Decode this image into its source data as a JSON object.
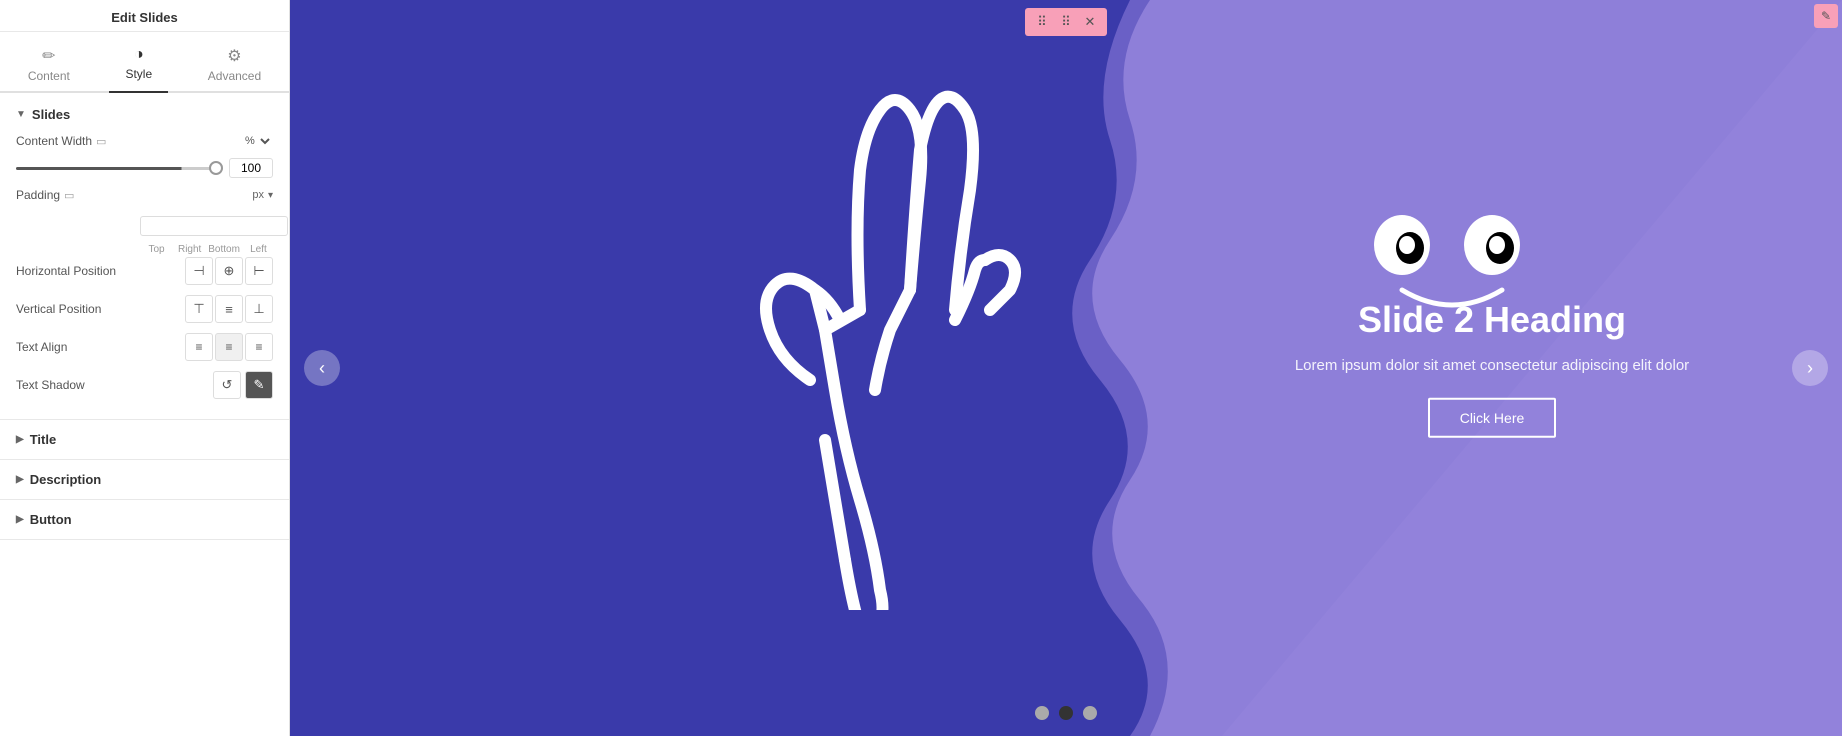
{
  "panel": {
    "header": "Edit Slides",
    "tabs": [
      {
        "id": "content",
        "label": "Content",
        "icon": "✏"
      },
      {
        "id": "style",
        "label": "Style",
        "icon": "◑",
        "active": true
      },
      {
        "id": "advanced",
        "label": "Advanced",
        "icon": "⚙"
      }
    ]
  },
  "sections": {
    "slides": {
      "title": "Slides",
      "expanded": true,
      "fields": {
        "content_width": {
          "label": "Content Width",
          "unit": "%",
          "value": "100"
        },
        "padding": {
          "label": "Padding",
          "unit": "px",
          "values": {
            "top": "",
            "right": "",
            "bottom": "",
            "left": ""
          }
        },
        "horizontal_position": {
          "label": "Horizontal Position"
        },
        "vertical_position": {
          "label": "Vertical Position"
        },
        "text_align": {
          "label": "Text Align"
        },
        "text_shadow": {
          "label": "Text Shadow"
        }
      }
    },
    "title": {
      "label": "Title",
      "expanded": false
    },
    "description": {
      "label": "Description",
      "expanded": false
    },
    "button": {
      "label": "Button",
      "expanded": false
    }
  },
  "slide": {
    "heading": "Slide 2 Heading",
    "description": "Lorem ipsum dolor sit amet consectetur adipiscing elit dolor",
    "button_label": "Click Here",
    "dots": [
      {
        "active": false
      },
      {
        "active": true
      },
      {
        "active": false
      }
    ]
  },
  "toolbar": {
    "move_icon": "⠿",
    "close_icon": "✕",
    "edit_icon": "✎"
  }
}
